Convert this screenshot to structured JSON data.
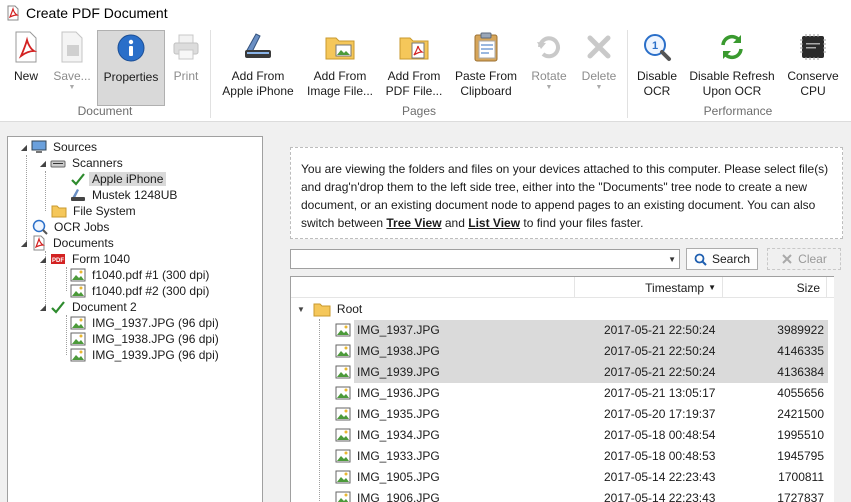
{
  "window": {
    "title": "Create PDF Document"
  },
  "ribbon": {
    "groups": {
      "document": "Document",
      "pages": "Pages",
      "performance": "Performance"
    },
    "buttons": {
      "new": "New",
      "save": "Save...",
      "properties": "Properties",
      "print": "Print",
      "add_iphone": [
        "Add From",
        "Apple iPhone"
      ],
      "add_image": [
        "Add From",
        "Image File..."
      ],
      "add_pdf": [
        "Add From",
        "PDF File..."
      ],
      "paste": [
        "Paste From",
        "Clipboard"
      ],
      "rotate": "Rotate",
      "delete": "Delete",
      "disable_ocr": [
        "Disable",
        "OCR"
      ],
      "disable_refresh": [
        "Disable Refresh",
        "Upon OCR"
      ],
      "conserve_cpu": [
        "Conserve",
        "CPU"
      ]
    }
  },
  "tree": {
    "sources": "Sources",
    "scanners": "Scanners",
    "apple_iphone": "Apple iPhone",
    "mustek": "Mustek 1248UB",
    "file_system": "File System",
    "ocr_jobs": "OCR Jobs",
    "documents": "Documents",
    "form1040": "Form 1040",
    "f1": "f1040.pdf #1 (300 dpi)",
    "f2": "f1040.pdf #2 (300 dpi)",
    "doc2": "Document 2",
    "img1": "IMG_1937.JPG (96 dpi)",
    "img2": "IMG_1938.JPG (96 dpi)",
    "img3": "IMG_1939.JPG (96 dpi)"
  },
  "info": {
    "text_before": "You are viewing the folders and files on your devices attached to this computer. Please select file(s) and drag'n'drop them to the left side tree, either into the \"Documents\" tree node to create a new document, or an existing document node to append pages to an existing document. You can also switch between ",
    "tree_view": "Tree View",
    "and": " and ",
    "list_view": "List View",
    "text_after": " to find your files faster."
  },
  "search": {
    "search_label": "Search",
    "clear_label": "Clear"
  },
  "list": {
    "headers": {
      "timestamp": "Timestamp",
      "size": "Size"
    },
    "root": "Root",
    "files": [
      {
        "name": "IMG_1937.JPG",
        "timestamp": "2017-05-21 22:50:24",
        "size": "3989922"
      },
      {
        "name": "IMG_1938.JPG",
        "timestamp": "2017-05-21 22:50:24",
        "size": "4146335"
      },
      {
        "name": "IMG_1939.JPG",
        "timestamp": "2017-05-21 22:50:24",
        "size": "4136384"
      },
      {
        "name": "IMG_1936.JPG",
        "timestamp": "2017-05-21 13:05:17",
        "size": "4055656"
      },
      {
        "name": "IMG_1935.JPG",
        "timestamp": "2017-05-20 17:19:37",
        "size": "2421500"
      },
      {
        "name": "IMG_1934.JPG",
        "timestamp": "2017-05-18 00:48:54",
        "size": "1995510"
      },
      {
        "name": "IMG_1933.JPG",
        "timestamp": "2017-05-18 00:48:53",
        "size": "1945795"
      },
      {
        "name": "IMG_1905.JPG",
        "timestamp": "2017-05-14 22:23:43",
        "size": "1700811"
      },
      {
        "name": "IMG_1906.JPG",
        "timestamp": "2017-05-14 22:23:43",
        "size": "1727837"
      }
    ]
  }
}
